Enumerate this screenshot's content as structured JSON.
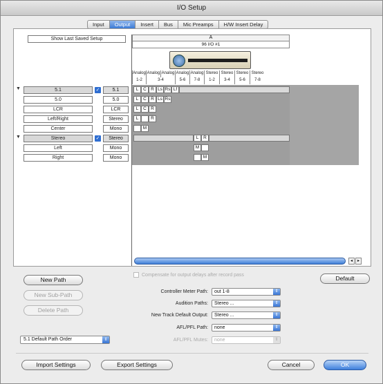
{
  "window": {
    "title": "I/O Setup"
  },
  "tabs": [
    {
      "label": "Input",
      "active": false
    },
    {
      "label": "Output",
      "active": true
    },
    {
      "label": "Insert",
      "active": false
    },
    {
      "label": "Bus",
      "active": false
    },
    {
      "label": "Mic Preamps",
      "active": false
    },
    {
      "label": "H/W Insert Delay",
      "active": false
    }
  ],
  "matrix": {
    "show_last_saved_label": "Show Last Saved Setup",
    "io_group": "A",
    "io_device": "96 I/O #1",
    "channel_headers": [
      "Analog",
      "Analog",
      "Analog",
      "Analog",
      "Analog",
      "Stereo",
      "Stereo",
      "Stereo",
      "Stereo"
    ],
    "channel_numbers": [
      "1-2",
      "3-4",
      "5-6",
      "7-8",
      "1-2",
      "3-4",
      "5-6",
      "7-8"
    ],
    "paths": [
      {
        "name": "5.1",
        "format": "5.1",
        "expandable": true,
        "checked": true
      },
      {
        "name": "5.0",
        "format": "5.0",
        "expandable": false,
        "checked": false
      },
      {
        "name": "LCR",
        "format": "LCR",
        "expandable": false,
        "checked": false
      },
      {
        "name": "Left/Right",
        "format": "Stereo",
        "expandable": false,
        "checked": false
      },
      {
        "name": "Center",
        "format": "Mono",
        "expandable": false,
        "checked": false
      },
      {
        "name": "Stereo",
        "format": "Stereo",
        "expandable": true,
        "checked": true
      },
      {
        "name": "Left",
        "format": "Mono",
        "expandable": false,
        "checked": false
      },
      {
        "name": "Right",
        "format": "Mono",
        "expandable": false,
        "checked": false
      }
    ],
    "assignments": [
      [
        "L",
        "C",
        "R",
        "Ls",
        "Rs",
        "Lf"
      ],
      [
        "L",
        "C",
        "R",
        "Ls",
        "Rs"
      ],
      [
        "L",
        "C",
        "R"
      ],
      [
        "L",
        "",
        "R"
      ],
      [
        "",
        "M"
      ],
      [
        "L",
        "R"
      ],
      [
        "M"
      ],
      [
        "M"
      ]
    ]
  },
  "options": {
    "compensate_label": "Compensate for output delays after record pass"
  },
  "left_buttons": {
    "new_path": "New Path",
    "new_sub_path": "New Sub-Path",
    "delete_path": "Delete Path",
    "default": "Default"
  },
  "settings": [
    {
      "label": "Controller Meter Path:",
      "value": "out 1-8",
      "enabled": true
    },
    {
      "label": "Audition Paths:",
      "value": "Stereo ...",
      "enabled": true
    },
    {
      "label": "New Track Default Output:",
      "value": "Stereo ...",
      "enabled": true
    },
    {
      "label": "AFL/PFL Path:",
      "value": "none",
      "enabled": true
    },
    {
      "label": "AFL/PFL Mutes:",
      "value": "none",
      "enabled": false
    }
  ],
  "path_order": {
    "value": "5.1 Default Path Order"
  },
  "footer": {
    "import_label": "Import Settings",
    "export_label": "Export Settings",
    "cancel_label": "Cancel",
    "ok_label": "OK"
  },
  "colors": {
    "accent": "#3b7ad6",
    "grid_gray": "#9e9e9e"
  }
}
